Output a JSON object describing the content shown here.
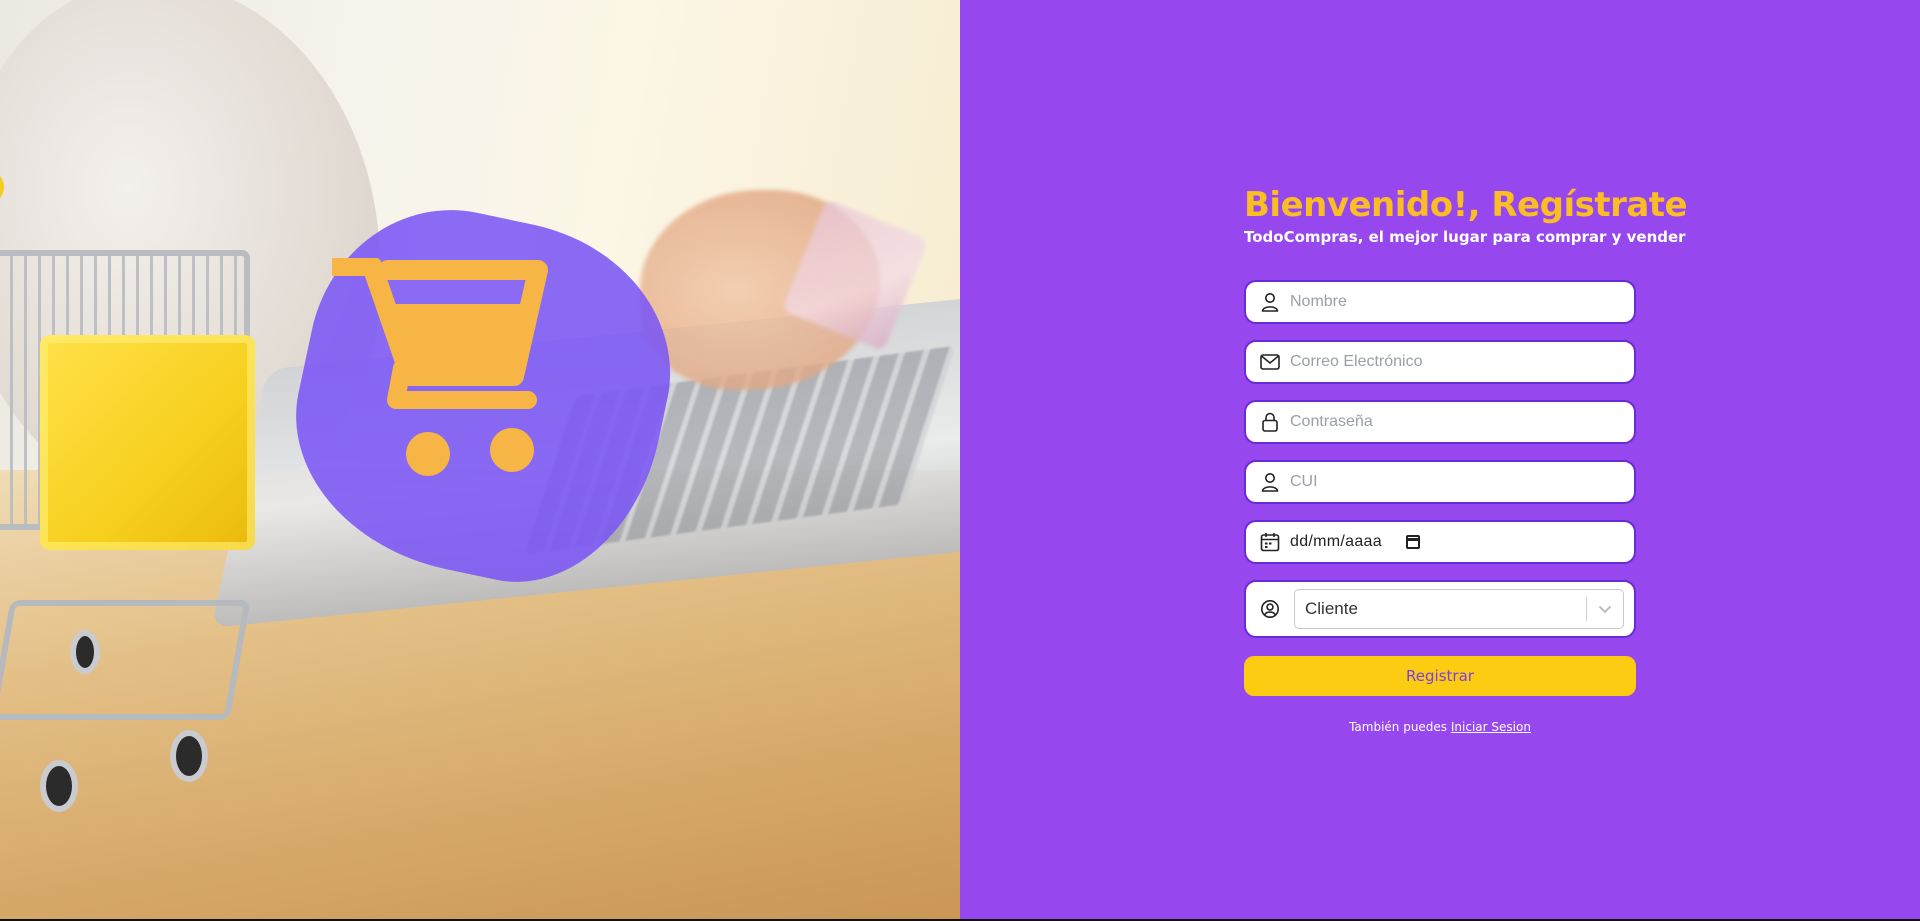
{
  "brand": {
    "accent_purple": "#9747ee",
    "accent_yellow": "#fbbd24",
    "button_yellow": "#fccc12"
  },
  "hero": {
    "logo_icon": "shopping-cart-icon"
  },
  "form": {
    "title": "Bienvenido!, Regístrate",
    "subtitle": "TodoCompras, el mejor lugar para comprar y vender",
    "fields": {
      "name": {
        "placeholder": "Nombre",
        "icon": "user-icon"
      },
      "email": {
        "placeholder": "Correo Electrónico",
        "icon": "mail-icon"
      },
      "password": {
        "placeholder": "Contraseña",
        "icon": "lock-icon"
      },
      "cui": {
        "placeholder": "CUI",
        "icon": "user-icon"
      },
      "birthdate": {
        "value": "dd/mm/aaaa",
        "icon": "calendar-icon"
      },
      "role": {
        "value": "Cliente",
        "icon": "user-circle-icon"
      }
    },
    "submit_label": "Registrar",
    "footer_text": "También puedes",
    "footer_link": "Iniciar Sesion"
  }
}
